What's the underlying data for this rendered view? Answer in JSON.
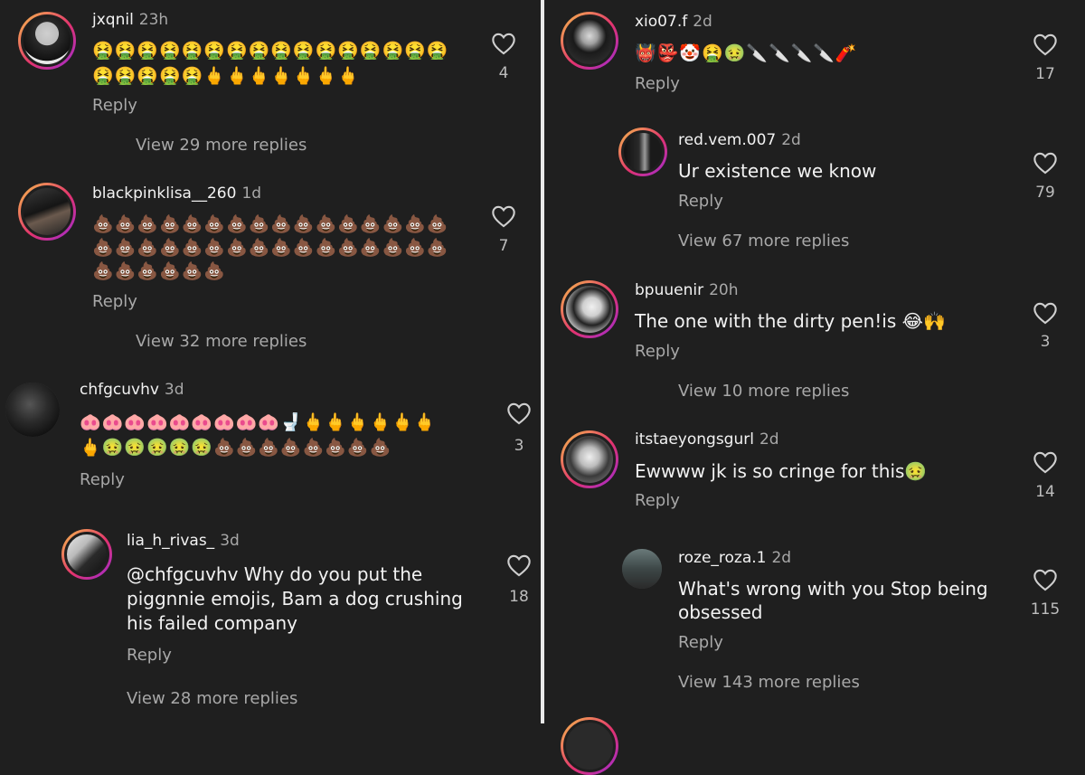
{
  "left_column": {
    "comments": [
      {
        "username": "jxqnil",
        "time": "23h",
        "emoji_line1": "🤮🤮🤮🤮🤮🤮🤮🤮🤮🤮🤮🤮🤮🤮🤮🤮",
        "emoji_line2": "🤮🤮🤮🤮🤮🖕🖕🖕🖕🖕🖕🖕",
        "reply_label": "Reply",
        "likes": "4",
        "view_more": "View 29 more replies"
      },
      {
        "username": "blackpinklisa__260",
        "time": "1d",
        "emoji_line1": "💩💩💩💩💩💩💩💩💩💩💩💩💩💩💩💩",
        "emoji_line2": "💩💩💩💩💩💩💩💩💩💩💩💩💩💩💩💩",
        "emoji_line3": "💩💩💩💩💩💩",
        "reply_label": "Reply",
        "likes": "7",
        "view_more": "View 32 more replies"
      },
      {
        "username": "chfgcuvhv",
        "time": "3d",
        "emoji_line1": "🐽🐽🐽🐽🐽🐽🐽🐽🐽🚽🖕🖕🖕🖕🖕🖕",
        "emoji_line2": "🖕🤢🤢🤢🤢🤢💩💩💩💩💩💩💩💩",
        "reply_label": "Reply",
        "likes": "3"
      },
      {
        "username": "lia_h_rivas_",
        "time": "3d",
        "text_line1": "@chfgcuvhv Why do you put the",
        "text_line2": "piggnnie emojis, Bam a dog crushing",
        "text_line3": "his failed company",
        "reply_label": "Reply",
        "likes": "18",
        "view_more": "View 28 more replies"
      }
    ]
  },
  "right_column": {
    "comments": [
      {
        "username": "xio07.f",
        "time": "2d",
        "emoji_line1": "👹👺🤡🤮🤢🔪🔪🔪🔪🧨",
        "reply_label": "Reply",
        "likes": "17"
      },
      {
        "username": "red.vem.007",
        "time": "2d",
        "text_line1": "Ur existence we know",
        "reply_label": "Reply",
        "likes": "79",
        "view_more": "View 67 more replies"
      },
      {
        "username": "bpuuenir",
        "time": "20h",
        "text_line1": "The one with the dirty pen!is 😂🙌",
        "reply_label": "Reply",
        "likes": "3",
        "view_more": "View 10 more replies"
      },
      {
        "username": "itstaeyongsgurl",
        "time": "2d",
        "text_line1": "Ewwww jk is so cringe for this🤢",
        "reply_label": "Reply",
        "likes": "14"
      },
      {
        "username": "roze_roza.1",
        "time": "2d",
        "text_line1": "What's wrong with you Stop being",
        "text_line2": "obsessed",
        "reply_label": "Reply",
        "likes": "115",
        "view_more": "View 143 more replies"
      }
    ]
  },
  "icons": {
    "like": "heart-icon"
  },
  "colors": {
    "background": "#1f1f1f",
    "secondary_text": "#a8a8a8",
    "ring_gradient": [
      "#f7c04a",
      "#e2336e",
      "#9c2bd6"
    ]
  }
}
